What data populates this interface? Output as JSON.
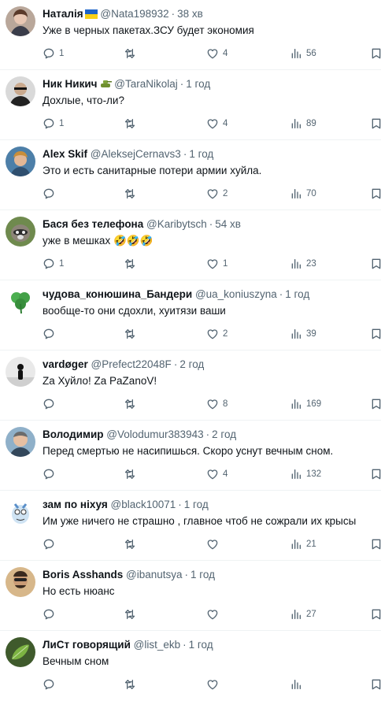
{
  "colors": {
    "text": "#0f1419",
    "secondary": "#536471",
    "divider": "#eff3f4"
  },
  "icons": {
    "reply": "reply-icon",
    "retweet": "retweet-icon",
    "like": "like-icon",
    "views": "views-icon",
    "bookmark": "bookmark-icon"
  },
  "tweets": [
    {
      "name": "Наталія",
      "badge": "ukraine-flag",
      "handle": "@Nata198932",
      "dot": "·",
      "time": "38 хв",
      "text": "Уже в черных пакетах.ЗСУ будет экономия",
      "replies": "1",
      "retweets": "",
      "likes": "4",
      "views": "56"
    },
    {
      "name": "Ник Никич",
      "badge": "tank-emoji",
      "handle": "@TaraNikolaj",
      "dot": "·",
      "time": "1 год",
      "text": "Дохлые, что-ли?",
      "replies": "1",
      "retweets": "",
      "likes": "4",
      "views": "89"
    },
    {
      "name": "Alex Skif",
      "badge": "",
      "handle": "@AleksejCernavs3",
      "dot": "·",
      "time": "1 год",
      "text": "Это и есть санитарные потери армии хуйла.",
      "replies": "",
      "retweets": "",
      "likes": "2",
      "views": "70"
    },
    {
      "name": "Бася без телефона",
      "badge": "",
      "handle": "@Karibytsch",
      "dot": "·",
      "time": "54 хв",
      "text": "уже в мешках 🤣🤣🤣",
      "replies": "1",
      "retweets": "",
      "likes": "1",
      "views": "23"
    },
    {
      "name": "чудова_конюшина_Бандери",
      "badge": "",
      "handle": "@ua_koniuszyna",
      "dot": "·",
      "time": "1 год",
      "text": "вообще-то они сдохли, хуитязи ваши",
      "replies": "",
      "retweets": "",
      "likes": "2",
      "views": "39"
    },
    {
      "name": "vardøger",
      "badge": "",
      "handle": "@Prefect22048F",
      "dot": "·",
      "time": "2 год",
      "text": "Za Хуйло! Za PaZanoV!",
      "replies": "",
      "retweets": "",
      "likes": "8",
      "views": "169"
    },
    {
      "name": "Володимир",
      "badge": "",
      "handle": "@Volodumur383943",
      "dot": "·",
      "time": "2 год",
      "text": "Перед смертью не насипишься. Скоро уснут вечным сном.",
      "replies": "",
      "retweets": "",
      "likes": "4",
      "views": "132"
    },
    {
      "name": "зам по ніхуя",
      "badge": "",
      "handle": "@black10071",
      "dot": "·",
      "time": "1 год",
      "text": "Им уже ничего не страшно , главное чтоб не сожрали их крысы",
      "replies": "",
      "retweets": "",
      "likes": "",
      "views": "21"
    },
    {
      "name": "Boris Asshands",
      "badge": "",
      "handle": "@ibanutsya",
      "dot": "·",
      "time": "1 год",
      "text": "Но есть нюанс",
      "replies": "",
      "retweets": "",
      "likes": "",
      "views": "27"
    },
    {
      "name": "ЛиСт говорящий",
      "badge": "",
      "handle": "@list_ekb",
      "dot": "·",
      "time": "1 год",
      "text": "Вечным сном",
      "replies": "",
      "retweets": "",
      "likes": "",
      "views": ""
    }
  ]
}
